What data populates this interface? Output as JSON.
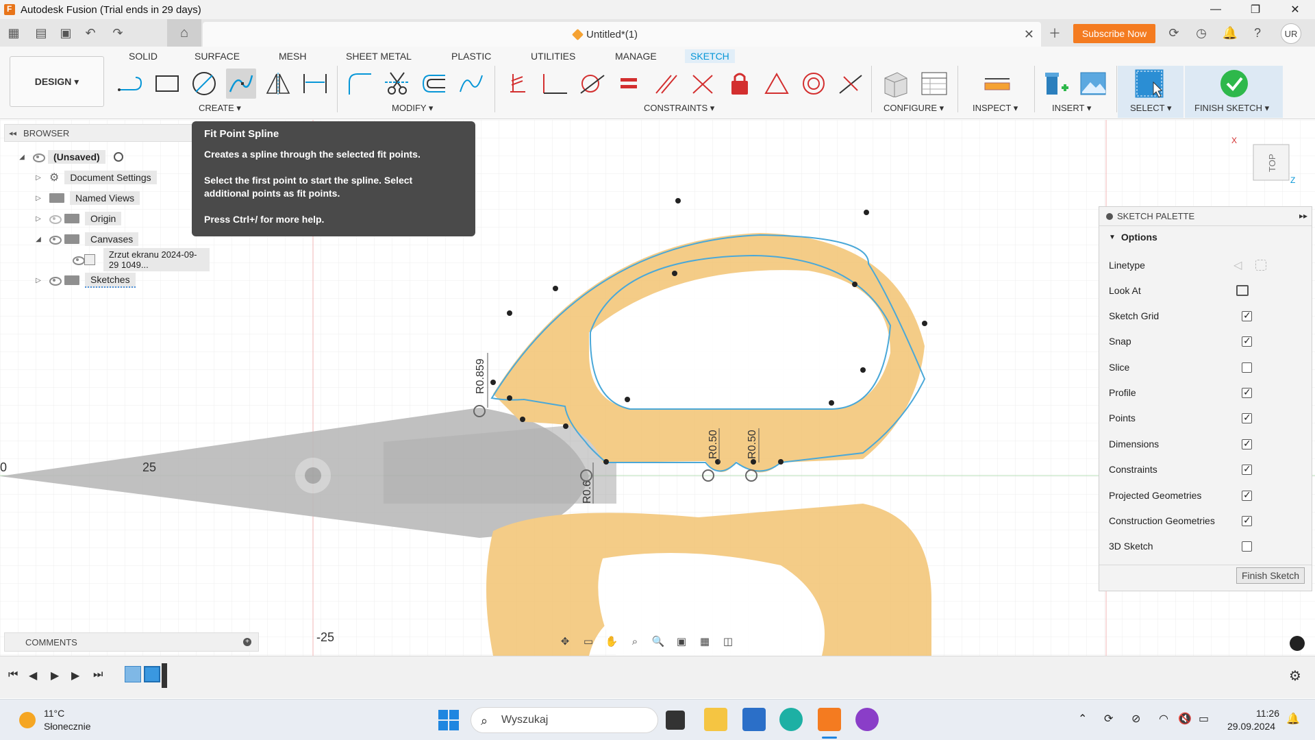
{
  "window": {
    "title": "Autodesk Fusion (Trial ends in 29 days)"
  },
  "topbar": {
    "document_name": "Untitled*(1)",
    "subscribe_label": "Subscribe Now",
    "user_initials": "UR"
  },
  "ribbon": {
    "workspace": "DESIGN ▾",
    "tabs": [
      "SOLID",
      "SURFACE",
      "MESH",
      "SHEET METAL",
      "PLASTIC",
      "UTILITIES",
      "MANAGE",
      "SKETCH"
    ],
    "active_tab": "SKETCH",
    "groups": [
      "CREATE ▾",
      "MODIFY ▾",
      "CONSTRAINTS ▾",
      "CONFIGURE ▾",
      "INSPECT ▾",
      "INSERT ▾",
      "SELECT ▾",
      "FINISH SKETCH ▾"
    ]
  },
  "browser": {
    "title": "BROWSER",
    "items": [
      {
        "label": "(Unsaved)"
      },
      {
        "label": "Document Settings"
      },
      {
        "label": "Named Views"
      },
      {
        "label": "Origin"
      },
      {
        "label": "Canvases"
      },
      {
        "label": "Zrzut ekranu 2024-09-29 1049..."
      },
      {
        "label": "Sketches"
      }
    ]
  },
  "tooltip": {
    "title": "Fit Point Spline",
    "line1": "Creates a spline through the selected fit points.",
    "line2": "Select the first point to start the spline. Select",
    "line3": "additional points as fit points.",
    "line4": "Press Ctrl+/ for more help."
  },
  "viewcube": {
    "face": "TOP",
    "x_axis": "X",
    "z_axis": "Z"
  },
  "canvas_labels": {
    "axis_25": "25",
    "axis_neg25": "-25",
    "axis_0": "0",
    "dim1": "R0.859",
    "dim2": "R0.50",
    "dim3": "R0.50",
    "dim4": "R0.6"
  },
  "palette": {
    "title": "SKETCH PALETTE",
    "section": "Options",
    "linetype": "Linetype",
    "look_at": "Look At",
    "options": [
      {
        "label": "Sketch Grid",
        "checked": true
      },
      {
        "label": "Snap",
        "checked": true
      },
      {
        "label": "Slice",
        "checked": false
      },
      {
        "label": "Profile",
        "checked": true
      },
      {
        "label": "Points",
        "checked": true
      },
      {
        "label": "Dimensions",
        "checked": true
      },
      {
        "label": "Constraints",
        "checked": true
      },
      {
        "label": "Projected Geometries",
        "checked": true
      },
      {
        "label": "Construction Geometries",
        "checked": true
      },
      {
        "label": "3D Sketch",
        "checked": false
      }
    ],
    "finish_label": "Finish Sketch"
  },
  "comments": {
    "label": "COMMENTS"
  },
  "taskbar": {
    "temperature": "11°C",
    "weather": "Słonecznie",
    "search_placeholder": "Wyszukaj",
    "time": "11:26",
    "date": "29.09.2024"
  },
  "colors": {
    "accent": "#0696d7",
    "subscribe": "#f47b20",
    "finish_green": "#2eb84b",
    "sketch_line": "#4aa8d8",
    "handle": "#f5b731"
  }
}
